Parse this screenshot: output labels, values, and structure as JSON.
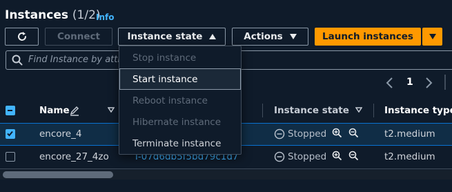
{
  "header": {
    "title": "Instances",
    "count": "(1/2)",
    "info_label": "Info"
  },
  "toolbar": {
    "refresh_icon": "refresh-icon",
    "connect_label": "Connect",
    "instance_state_label": "Instance state",
    "actions_label": "Actions",
    "launch_label": "Launch instances"
  },
  "search": {
    "placeholder": "Find Instance by attri"
  },
  "pagination": {
    "current_page": "1"
  },
  "table": {
    "columns": {
      "name": "Name",
      "instance_state": "Instance state",
      "instance_type": "Instance type"
    },
    "rows": [
      {
        "name": "encore_4",
        "instance_id": "",
        "state": "Stopped",
        "type": "t2.medium",
        "selected": true
      },
      {
        "name": "encore_27_4zo",
        "instance_id": "i-07d6db5f5bd79c1d7",
        "state": "Stopped",
        "type": "t2.medium",
        "selected": false
      }
    ]
  },
  "instance_state_menu": {
    "items": [
      {
        "label": "Stop instance",
        "enabled": false
      },
      {
        "label": "Start instance",
        "enabled": true,
        "hovered": true
      },
      {
        "label": "Reboot instance",
        "enabled": false
      },
      {
        "label": "Hibernate instance",
        "enabled": false
      },
      {
        "label": "Terminate instance",
        "enabled": true
      }
    ]
  },
  "colors": {
    "background": "#0f1b2a",
    "primary": "#ff9900",
    "link": "#42b4ff",
    "selected_row": "#102d46"
  }
}
